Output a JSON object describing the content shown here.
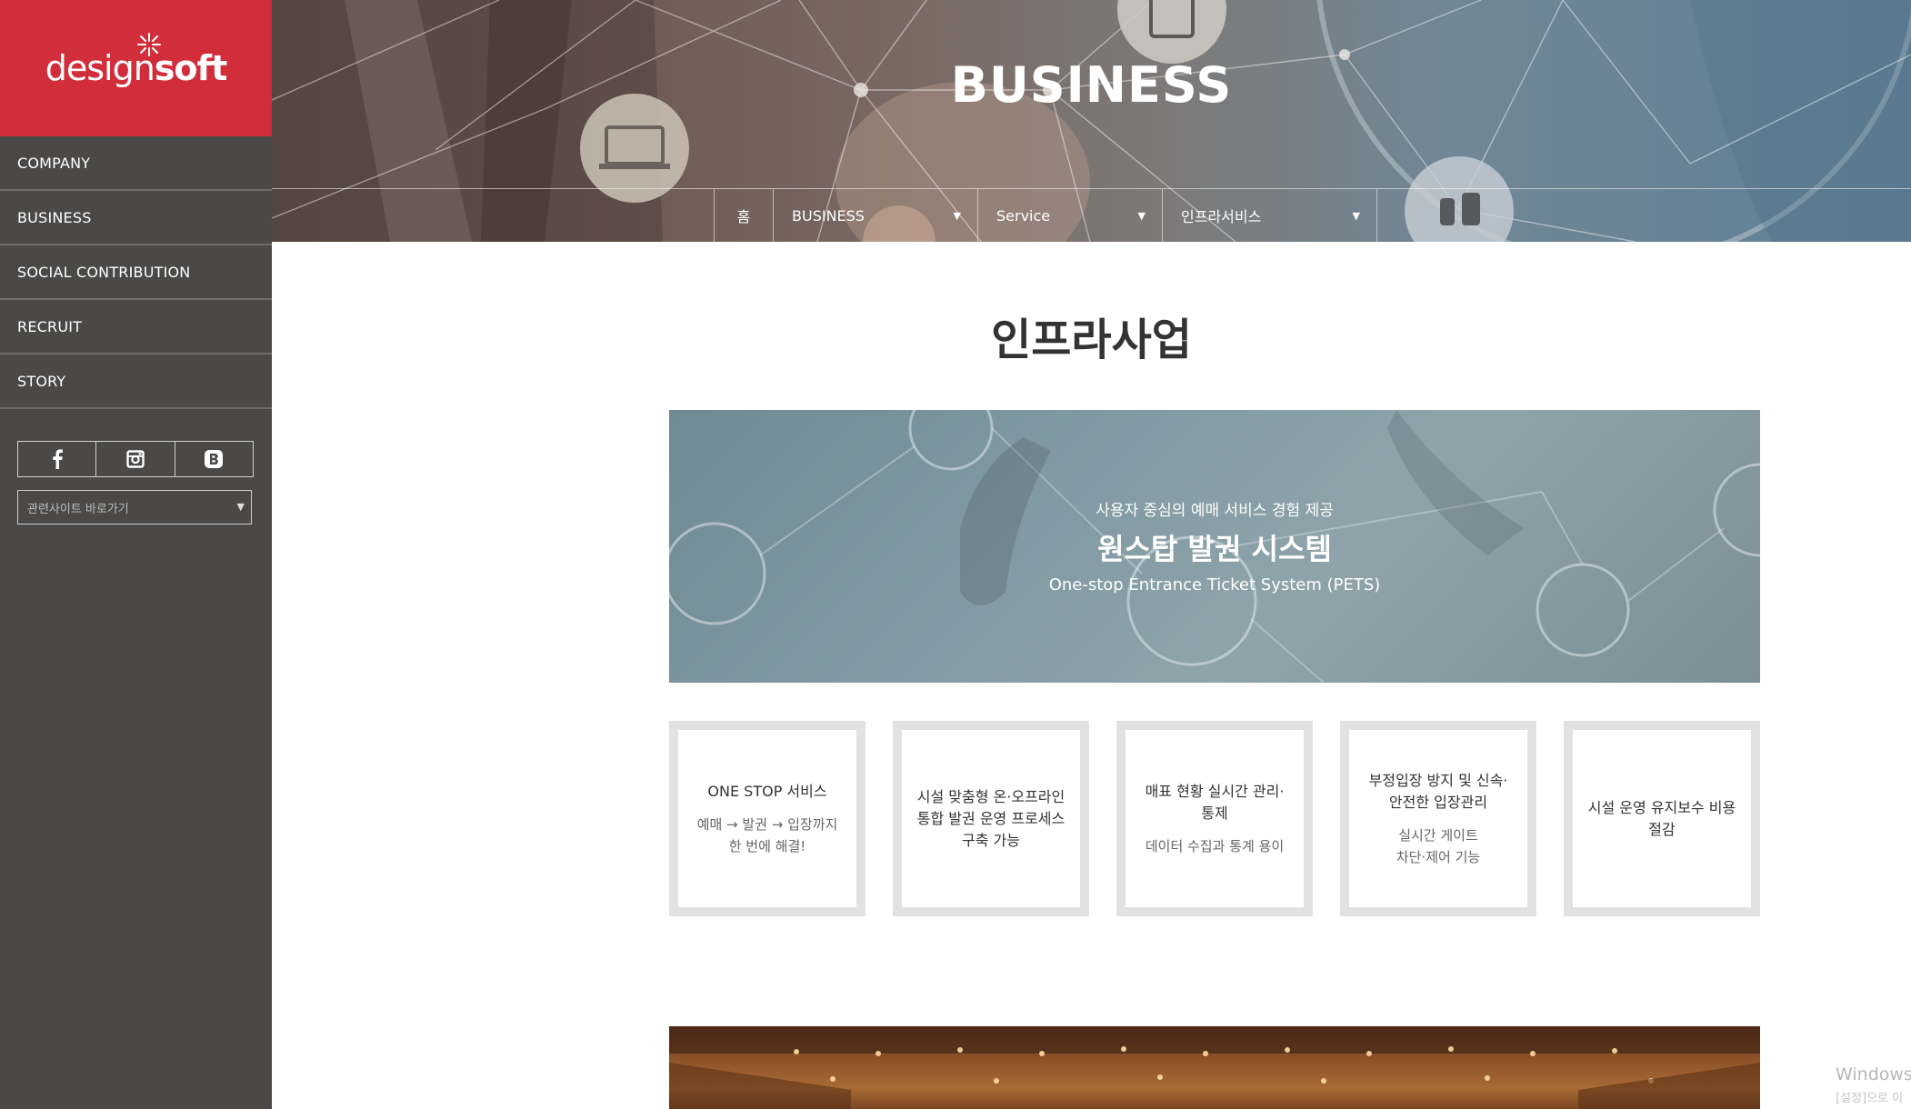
{
  "brand": {
    "logo_regular": "design",
    "logo_bold": "soft",
    "logo_text_full": "designsoft",
    "color": "#d22d3a"
  },
  "sidebar": {
    "items": [
      {
        "label": "COMPANY"
      },
      {
        "label": "BUSINESS"
      },
      {
        "label": "SOCIAL CONTRIBUTION"
      },
      {
        "label": "RECRUIT"
      },
      {
        "label": "STORY"
      }
    ],
    "social": [
      {
        "icon": "facebook-icon"
      },
      {
        "icon": "instagram-icon"
      },
      {
        "icon": "blog-icon"
      }
    ],
    "related_sites_placeholder": "관련사이트 바로가기"
  },
  "hero": {
    "title": "BUSINESS",
    "breadcrumb": {
      "home": "홈",
      "level1": "BUSINESS",
      "level2": "Service",
      "level3": "인프라서비스"
    }
  },
  "main": {
    "page_title": "인프라사업",
    "banner": {
      "subtitle": "사용자 중심의 예매 서비스 경험 제공",
      "title": "원스탑 발권 시스템",
      "english": "One-stop Entrance Ticket System (PETS)"
    },
    "features": [
      {
        "title_lines": [
          "ONE STOP 서비스"
        ],
        "desc_lines": [
          "예매 → 발권 → 입장까지",
          "한 번에 해결!"
        ]
      },
      {
        "title_lines": [
          "시설 맞춤형 온·오프라인",
          "통합 발권 운영 프로세스",
          "구축 가능"
        ],
        "desc_lines": []
      },
      {
        "title_lines": [
          "매표 현황 실시간 관리·",
          "통제"
        ],
        "desc_lines": [
          "데이터 수집과 통계 용이"
        ]
      },
      {
        "title_lines": [
          "부정입장 방지 및 신속·",
          "안전한 입장관리"
        ],
        "desc_lines": [
          "실시간 게이트",
          "차단·제어 기능"
        ]
      },
      {
        "title_lines": [
          "시설 운영 유지보수 비용",
          "절감"
        ],
        "desc_lines": []
      }
    ]
  },
  "watermark": {
    "line1": "Windows",
    "line2": "[설정]으로 이"
  }
}
